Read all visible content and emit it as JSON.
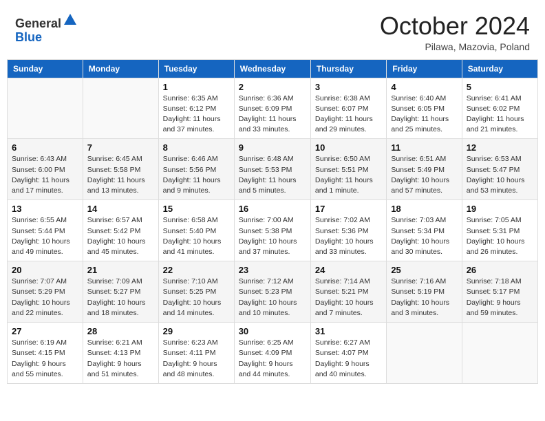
{
  "header": {
    "logo_line1": "General",
    "logo_line2": "Blue",
    "month": "October 2024",
    "location": "Pilawa, Mazovia, Poland"
  },
  "weekdays": [
    "Sunday",
    "Monday",
    "Tuesday",
    "Wednesday",
    "Thursday",
    "Friday",
    "Saturday"
  ],
  "weeks": [
    [
      {
        "day": "",
        "detail": ""
      },
      {
        "day": "",
        "detail": ""
      },
      {
        "day": "1",
        "detail": "Sunrise: 6:35 AM\nSunset: 6:12 PM\nDaylight: 11 hours and 37 minutes."
      },
      {
        "day": "2",
        "detail": "Sunrise: 6:36 AM\nSunset: 6:09 PM\nDaylight: 11 hours and 33 minutes."
      },
      {
        "day": "3",
        "detail": "Sunrise: 6:38 AM\nSunset: 6:07 PM\nDaylight: 11 hours and 29 minutes."
      },
      {
        "day": "4",
        "detail": "Sunrise: 6:40 AM\nSunset: 6:05 PM\nDaylight: 11 hours and 25 minutes."
      },
      {
        "day": "5",
        "detail": "Sunrise: 6:41 AM\nSunset: 6:02 PM\nDaylight: 11 hours and 21 minutes."
      }
    ],
    [
      {
        "day": "6",
        "detail": "Sunrise: 6:43 AM\nSunset: 6:00 PM\nDaylight: 11 hours and 17 minutes."
      },
      {
        "day": "7",
        "detail": "Sunrise: 6:45 AM\nSunset: 5:58 PM\nDaylight: 11 hours and 13 minutes."
      },
      {
        "day": "8",
        "detail": "Sunrise: 6:46 AM\nSunset: 5:56 PM\nDaylight: 11 hours and 9 minutes."
      },
      {
        "day": "9",
        "detail": "Sunrise: 6:48 AM\nSunset: 5:53 PM\nDaylight: 11 hours and 5 minutes."
      },
      {
        "day": "10",
        "detail": "Sunrise: 6:50 AM\nSunset: 5:51 PM\nDaylight: 11 hours and 1 minute."
      },
      {
        "day": "11",
        "detail": "Sunrise: 6:51 AM\nSunset: 5:49 PM\nDaylight: 10 hours and 57 minutes."
      },
      {
        "day": "12",
        "detail": "Sunrise: 6:53 AM\nSunset: 5:47 PM\nDaylight: 10 hours and 53 minutes."
      }
    ],
    [
      {
        "day": "13",
        "detail": "Sunrise: 6:55 AM\nSunset: 5:44 PM\nDaylight: 10 hours and 49 minutes."
      },
      {
        "day": "14",
        "detail": "Sunrise: 6:57 AM\nSunset: 5:42 PM\nDaylight: 10 hours and 45 minutes."
      },
      {
        "day": "15",
        "detail": "Sunrise: 6:58 AM\nSunset: 5:40 PM\nDaylight: 10 hours and 41 minutes."
      },
      {
        "day": "16",
        "detail": "Sunrise: 7:00 AM\nSunset: 5:38 PM\nDaylight: 10 hours and 37 minutes."
      },
      {
        "day": "17",
        "detail": "Sunrise: 7:02 AM\nSunset: 5:36 PM\nDaylight: 10 hours and 33 minutes."
      },
      {
        "day": "18",
        "detail": "Sunrise: 7:03 AM\nSunset: 5:34 PM\nDaylight: 10 hours and 30 minutes."
      },
      {
        "day": "19",
        "detail": "Sunrise: 7:05 AM\nSunset: 5:31 PM\nDaylight: 10 hours and 26 minutes."
      }
    ],
    [
      {
        "day": "20",
        "detail": "Sunrise: 7:07 AM\nSunset: 5:29 PM\nDaylight: 10 hours and 22 minutes."
      },
      {
        "day": "21",
        "detail": "Sunrise: 7:09 AM\nSunset: 5:27 PM\nDaylight: 10 hours and 18 minutes."
      },
      {
        "day": "22",
        "detail": "Sunrise: 7:10 AM\nSunset: 5:25 PM\nDaylight: 10 hours and 14 minutes."
      },
      {
        "day": "23",
        "detail": "Sunrise: 7:12 AM\nSunset: 5:23 PM\nDaylight: 10 hours and 10 minutes."
      },
      {
        "day": "24",
        "detail": "Sunrise: 7:14 AM\nSunset: 5:21 PM\nDaylight: 10 hours and 7 minutes."
      },
      {
        "day": "25",
        "detail": "Sunrise: 7:16 AM\nSunset: 5:19 PM\nDaylight: 10 hours and 3 minutes."
      },
      {
        "day": "26",
        "detail": "Sunrise: 7:18 AM\nSunset: 5:17 PM\nDaylight: 9 hours and 59 minutes."
      }
    ],
    [
      {
        "day": "27",
        "detail": "Sunrise: 6:19 AM\nSunset: 4:15 PM\nDaylight: 9 hours and 55 minutes."
      },
      {
        "day": "28",
        "detail": "Sunrise: 6:21 AM\nSunset: 4:13 PM\nDaylight: 9 hours and 51 minutes."
      },
      {
        "day": "29",
        "detail": "Sunrise: 6:23 AM\nSunset: 4:11 PM\nDaylight: 9 hours and 48 minutes."
      },
      {
        "day": "30",
        "detail": "Sunrise: 6:25 AM\nSunset: 4:09 PM\nDaylight: 9 hours and 44 minutes."
      },
      {
        "day": "31",
        "detail": "Sunrise: 6:27 AM\nSunset: 4:07 PM\nDaylight: 9 hours and 40 minutes."
      },
      {
        "day": "",
        "detail": ""
      },
      {
        "day": "",
        "detail": ""
      }
    ]
  ]
}
